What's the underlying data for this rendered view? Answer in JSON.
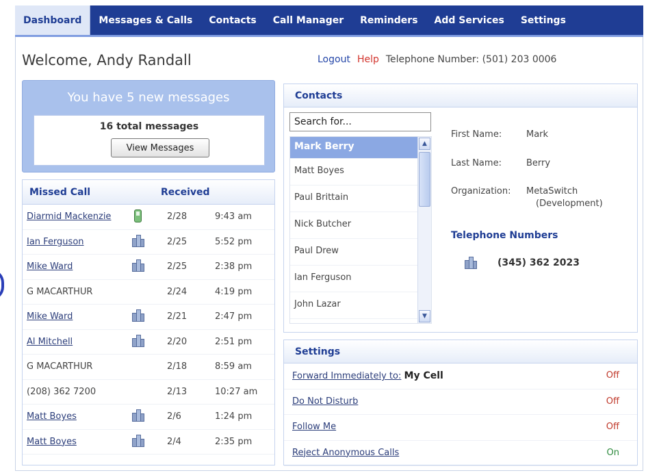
{
  "nav": {
    "items": [
      {
        "label": "Dashboard",
        "active": true
      },
      {
        "label": "Messages & Calls",
        "active": false
      },
      {
        "label": "Contacts",
        "active": false
      },
      {
        "label": "Call Manager",
        "active": false
      },
      {
        "label": "Reminders",
        "active": false
      },
      {
        "label": "Add Services",
        "active": false
      },
      {
        "label": "Settings",
        "active": false
      }
    ]
  },
  "header": {
    "welcome": "Welcome, Andy Randall",
    "logout": "Logout",
    "help": "Help",
    "telephone": "Telephone Number: (501) 203 0006"
  },
  "messages": {
    "title": "You have 5 new messages",
    "total": "16 total messages",
    "view_button": "View Messages"
  },
  "missed_calls": {
    "col_missed": "Missed Call",
    "col_received": "Received",
    "rows": [
      {
        "name": "Diarmid Mackenzie",
        "link": true,
        "icon": "mobile-phone-icon",
        "date": "2/28",
        "time": "9:43 am"
      },
      {
        "name": "Ian Ferguson",
        "link": true,
        "icon": "office-phone-icon",
        "date": "2/25",
        "time": "5:52 pm"
      },
      {
        "name": "Mike Ward",
        "link": true,
        "icon": "office-phone-icon",
        "date": "2/25",
        "time": "2:38 pm"
      },
      {
        "name": "G MACARTHUR",
        "link": false,
        "icon": "",
        "date": "2/24",
        "time": "4:19 pm"
      },
      {
        "name": "Mike Ward",
        "link": true,
        "icon": "office-phone-icon",
        "date": "2/21",
        "time": "2:47 pm"
      },
      {
        "name": "Al Mitchell",
        "link": true,
        "icon": "office-phone-icon",
        "date": "2/20",
        "time": "2:51 pm"
      },
      {
        "name": "G MACARTHUR",
        "link": false,
        "icon": "",
        "date": "2/18",
        "time": "8:59 am"
      },
      {
        "name": "(208) 362 7200",
        "link": false,
        "icon": "",
        "date": "2/13",
        "time": "10:27 am"
      },
      {
        "name": "Matt Boyes",
        "link": true,
        "icon": "office-phone-icon",
        "date": "2/6",
        "time": "1:24 pm"
      },
      {
        "name": "Matt Boyes",
        "link": true,
        "icon": "office-phone-icon",
        "date": "2/4",
        "time": "2:35 pm"
      }
    ]
  },
  "contacts": {
    "title": "Contacts",
    "search_value": "Search for...",
    "list": [
      "Mark Berry",
      "Matt Boyes",
      "Paul Brittain",
      "Nick Butcher",
      "Paul Drew",
      "Ian Ferguson",
      "John Lazar"
    ],
    "selected": "Mark Berry",
    "detail": {
      "first_name_label": "First Name:",
      "first_name": "Mark",
      "last_name_label": "Last Name:",
      "last_name": "Berry",
      "org_label": "Organization:",
      "org_line1": "MetaSwitch",
      "org_line2": "(Development)"
    },
    "telephone_heading": "Telephone Numbers",
    "telephone_number": "(345) 362 2023"
  },
  "settings": {
    "title": "Settings",
    "rows": [
      {
        "label": "Forward Immediately to:",
        "target": "My Cell",
        "state": "Off",
        "color": "#c0392b"
      },
      {
        "label": "Do Not Disturb",
        "target": "",
        "state": "Off",
        "color": "#c0392b"
      },
      {
        "label": "Follow Me",
        "target": "",
        "state": "Off",
        "color": "#c0392b"
      },
      {
        "label": "Reject Anonymous Calls",
        "target": "",
        "state": "On",
        "color": "#2e8b3e"
      }
    ]
  },
  "colors": {
    "nav_bg": "#1f3d94",
    "accent": "#1f3d94",
    "message_box": "#a9c1ec",
    "selected_contact": "#8ba8e3"
  }
}
